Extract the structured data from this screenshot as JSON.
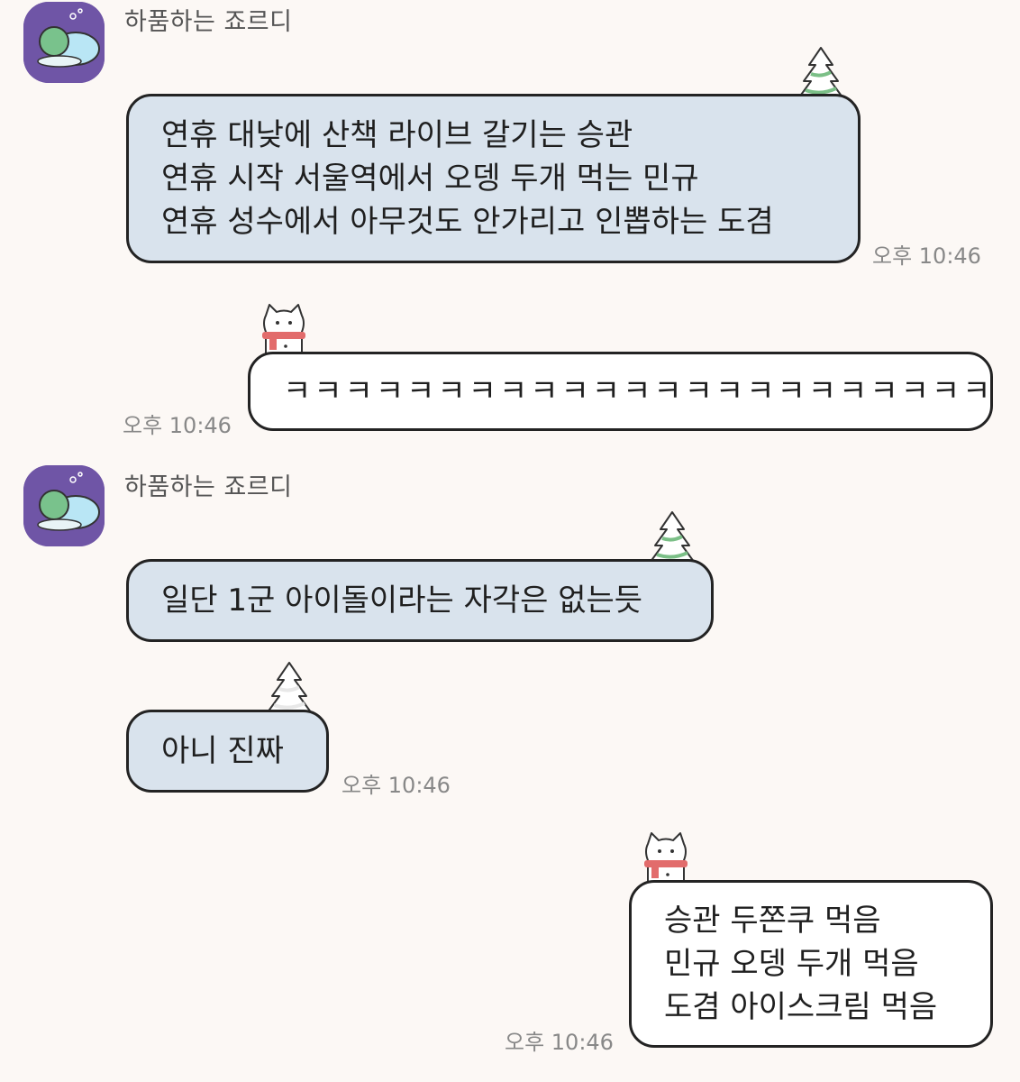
{
  "colors": {
    "background": "#fcf8f5",
    "incoming_bubble": "#d9e3ed",
    "outgoing_bubble": "#ffffff",
    "avatar_bg": "#6f55a6",
    "timestamp": "#888888"
  },
  "icons": {
    "incoming_decoration": "snowy-tree-icon",
    "outgoing_decoration": "snowman-cat-icon"
  },
  "messages": [
    {
      "direction": "incoming",
      "sender": "하품하는 죠르디",
      "lines": [
        "연휴 대낮에 산책 라이브 갈기는 승관",
        "연휴 시작 서울역에서 오뎅 두개 먹는 민규",
        "연휴 성수에서 아무것도 안가리고 인뽑하는 도겸"
      ],
      "time": "오후 10:46"
    },
    {
      "direction": "outgoing",
      "lines": [
        "ㅋㅋㅋㅋㅋㅋㅋㅋㅋㅋㅋㅋㅋㅋㅋㅋㅋㅋㅋㅋㅋㅋㅋ"
      ],
      "time": "오후 10:46"
    },
    {
      "direction": "incoming",
      "sender": "하품하는 죠르디",
      "lines": [
        "일단 1군 아이돌이라는 자각은 없는듯"
      ]
    },
    {
      "direction": "incoming",
      "lines": [
        "아니 진짜"
      ],
      "time": "오후 10:46"
    },
    {
      "direction": "outgoing",
      "lines": [
        "승관 두쫀쿠 먹음",
        "민규 오뎅 두개 먹음",
        "도겸 아이스크림 먹음"
      ],
      "time": "오후 10:46"
    }
  ]
}
